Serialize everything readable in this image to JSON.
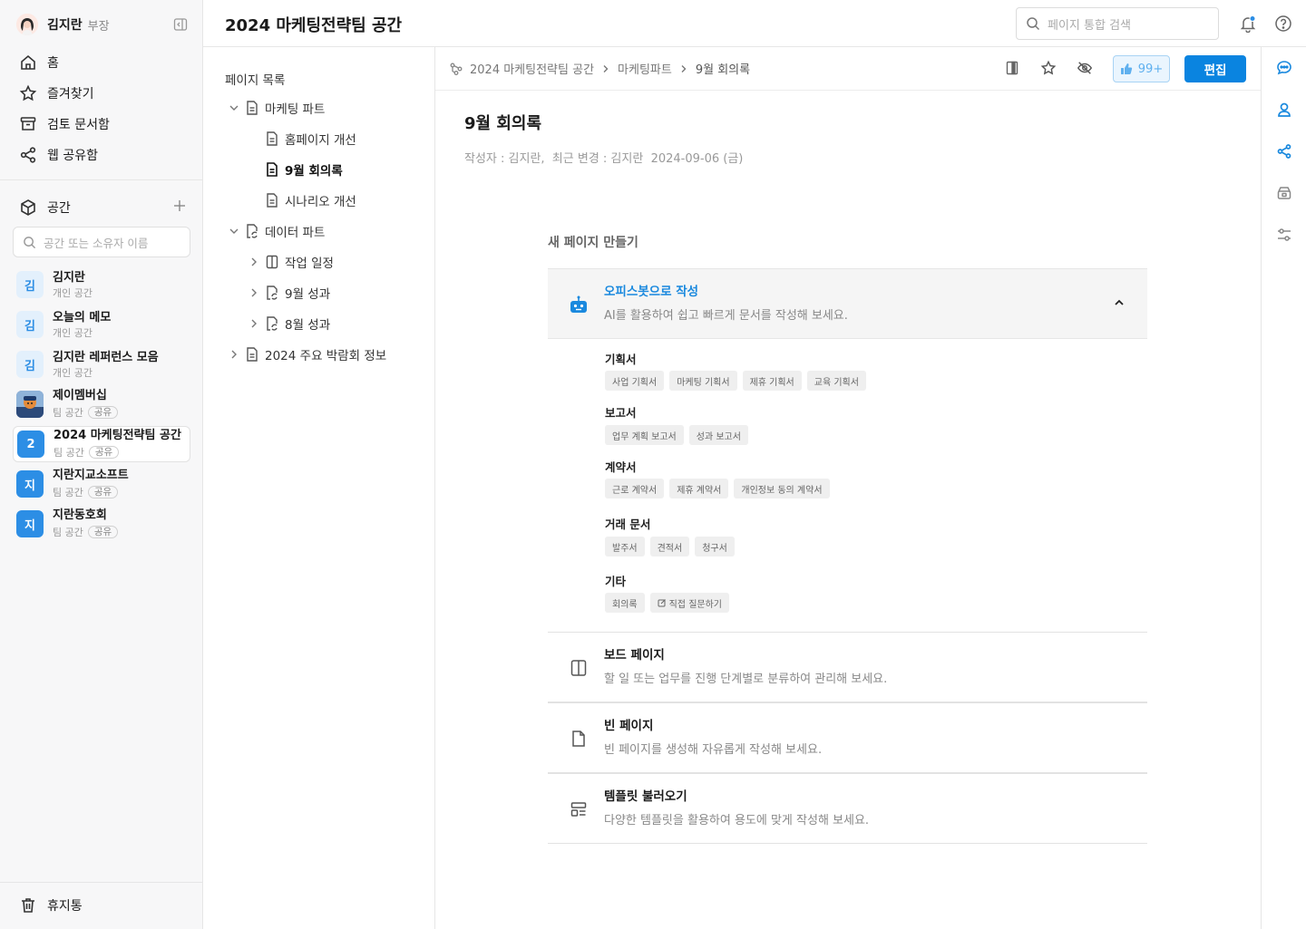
{
  "user": {
    "name": "김지란",
    "role": "부장"
  },
  "nav": [
    {
      "label": "홈",
      "icon": "home-icon"
    },
    {
      "label": "즐겨찾기",
      "icon": "star-icon"
    },
    {
      "label": "검토 문서함",
      "icon": "inbox-icon"
    },
    {
      "label": "웹 공유함",
      "icon": "share-icon"
    }
  ],
  "spaces_header": {
    "label": "공간",
    "search_placeholder": "공간 또는 소유자 이름"
  },
  "spaces": [
    {
      "avatar": "김",
      "name": "김지란",
      "sub": "개인 공간",
      "badge": ""
    },
    {
      "avatar": "김",
      "name": "오늘의 메모",
      "sub": "개인 공간",
      "badge": ""
    },
    {
      "avatar": "김",
      "name": "김지란 레퍼런스 모음",
      "sub": "개인 공간",
      "badge": ""
    },
    {
      "avatar": "",
      "name": "제이멤버십",
      "sub": "팀 공간",
      "badge": "공유"
    },
    {
      "avatar": "2",
      "name": "2024 마케팅전략팀 공간",
      "sub": "팀 공간",
      "badge": "공유"
    },
    {
      "avatar": "지",
      "name": "지란지교소프트",
      "sub": "팀 공간",
      "badge": "공유"
    },
    {
      "avatar": "지",
      "name": "지란동호회",
      "sub": "팀 공간",
      "badge": "공유"
    }
  ],
  "trash": {
    "label": "휴지통"
  },
  "header": {
    "title": "2024 마케팅전략팀 공간",
    "search_placeholder": "페이지 통합 검색"
  },
  "tree": {
    "title": "페이지 목록",
    "nodes": [
      {
        "label": "마케팅 파트"
      },
      {
        "label": "홈페이지 개선"
      },
      {
        "label": "9월 회의록"
      },
      {
        "label": "시나리오 개선"
      },
      {
        "label": "데이터 파트"
      },
      {
        "label": "작업 일정"
      },
      {
        "label": "9월 성과"
      },
      {
        "label": "8월 성과"
      },
      {
        "label": "2024 주요 박람회 정보"
      }
    ]
  },
  "breadcrumb": [
    "2024 마케팅전략팀 공간",
    "마케팅파트",
    "9월 회의록"
  ],
  "toolbar": {
    "like_count": "99+",
    "edit_label": "편집"
  },
  "document": {
    "title": "9월 회의록",
    "meta": "작성자 : 김지란,  최근 변경 : 김지란  2024-09-06 (금)"
  },
  "new_page": {
    "title": "새 페이지 만들기",
    "ai": {
      "title": "오피스봇으로 작성",
      "desc": "AI를 활용하여 쉽고 빠르게 문서를 작성해 보세요."
    },
    "categories": [
      {
        "label": "기획서",
        "chips": [
          "사업 기획서",
          "마케팅 기획서",
          "제휴 기획서",
          "교육 기획서"
        ]
      },
      {
        "label": "보고서",
        "chips": [
          "업무 계획 보고서",
          "성과 보고서"
        ]
      },
      {
        "label": "계약서",
        "chips": [
          "근로 계약서",
          "제휴 계약서",
          "개인정보 동의 계약서"
        ]
      },
      {
        "label": "거래 문서",
        "chips": [
          "발주서",
          "견적서",
          "청구서"
        ]
      },
      {
        "label": "기타",
        "chips": [
          "회의록",
          "직접 질문하기"
        ]
      }
    ],
    "options": [
      {
        "title": "보드 페이지",
        "desc": "할 일 또는 업무를 진행 단계별로 분류하여 관리해 보세요."
      },
      {
        "title": "빈 페이지",
        "desc": "빈 페이지를 생성해 자유롭게 작성해 보세요."
      },
      {
        "title": "템플릿 불러오기",
        "desc": "다양한 템플릿을 활용하여 용도에 맞게 작성해 보세요."
      }
    ]
  },
  "colors": {
    "accent": "#0a84e0",
    "ai_title": "#1a89de",
    "avatar_dark": "#2c8ee5",
    "avatar_light": "#e3f0fc"
  }
}
